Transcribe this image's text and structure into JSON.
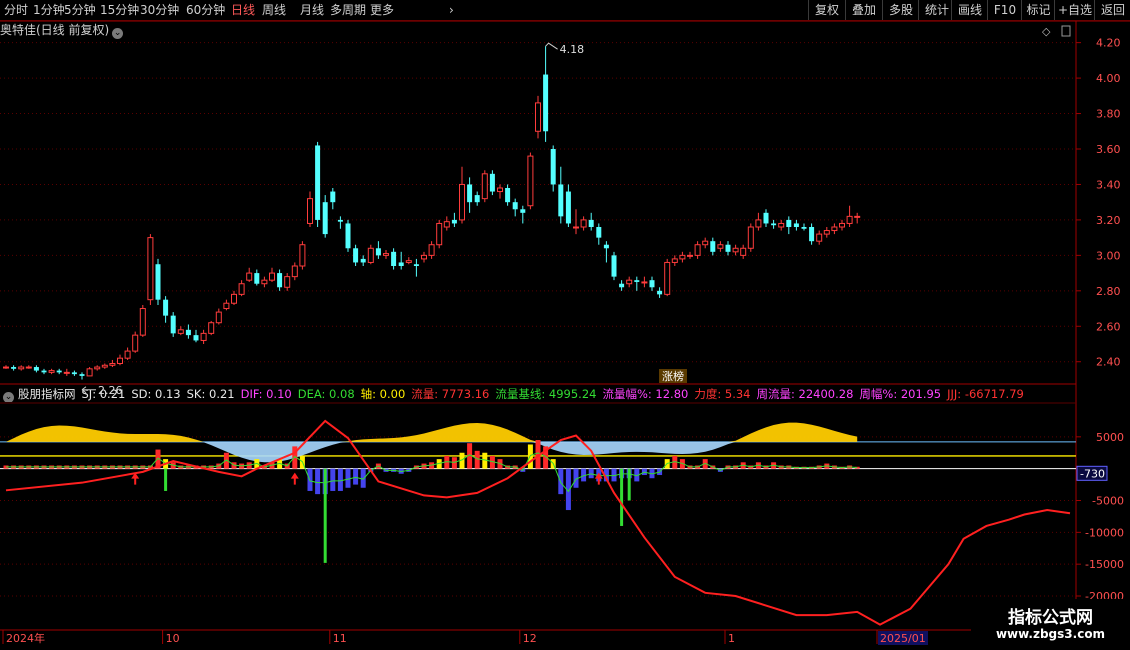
{
  "toolbar": {
    "periods": [
      "分时",
      "1分钟",
      "5分钟",
      "15分钟",
      "30分钟",
      "60分钟",
      "日线",
      "周线",
      "月线",
      "多周期",
      "更多"
    ],
    "active": "日线",
    "more_glyph": "›",
    "right": [
      "复权",
      "叠加",
      "多股",
      "统计",
      "画线",
      "F10",
      "标记",
      "+自选",
      "返回"
    ]
  },
  "title": {
    "text": "奥特佳(日线 前复权)",
    "glyph": "⌄"
  },
  "indicator": {
    "glyph": "⌄",
    "name": "股朋指标网",
    "items": [
      {
        "text": "SJ: 0.21",
        "color": "#e8e8e8"
      },
      {
        "text": "SD: 0.13",
        "color": "#e8e8e8"
      },
      {
        "text": "SK: 0.21",
        "color": "#e8e8e8"
      },
      {
        "text": "DIF: 0.10",
        "color": "#ff44ff"
      },
      {
        "text": "DEA: 0.08",
        "color": "#33dd33"
      },
      {
        "text": "轴: 0.00",
        "color": "#ffee00"
      },
      {
        "text": "流量: 7773.16",
        "color": "#ff3333"
      },
      {
        "text": "流量基线: 4995.24",
        "color": "#33dd33"
      },
      {
        "text": "流量幅%: 12.80",
        "color": "#ff44ff"
      },
      {
        "text": "力度: 5.34",
        "color": "#ff3333"
      },
      {
        "text": "周流量: 22400.28",
        "color": "#ff44ff"
      },
      {
        "text": "周幅%: 201.95",
        "color": "#ff44ff"
      },
      {
        "text": "JJJ: -66717.79",
        "color": "#ff3333"
      }
    ]
  },
  "price_axis": {
    "ticks": [
      "4.20",
      "4.00",
      "3.80",
      "3.60",
      "3.40",
      "3.20",
      "3.00",
      "2.80",
      "2.60",
      "2.40"
    ],
    "values": [
      4.2,
      4.0,
      3.8,
      3.6,
      3.4,
      3.2,
      3.0,
      2.8,
      2.6,
      2.4
    ],
    "range": [
      2.28,
      4.26
    ]
  },
  "ind_axis": {
    "ticks": [
      "5000",
      "-5000",
      "-10000",
      "-15000",
      "-20000"
    ],
    "values": [
      5000,
      -5000,
      -10000,
      -15000,
      -20000
    ],
    "range": [
      -20000,
      10000
    ],
    "current": "-730",
    "current_value": -730
  },
  "date_axis": {
    "labels": [
      {
        "text": "2024年",
        "index": 0
      },
      {
        "text": "10",
        "index": 21
      },
      {
        "text": "11",
        "index": 43
      },
      {
        "text": "12",
        "index": 68
      },
      {
        "text": "1",
        "index": 95
      },
      {
        "text": "2025/01",
        "index": 115
      }
    ]
  },
  "annotations": {
    "high": "4.18",
    "low": "2.26",
    "limit_up_tag": "涨榜"
  },
  "colors": {
    "up": "#ff3c3c",
    "down": "#54ffff",
    "grid": "#5a0000",
    "axis": "#a00000",
    "volume_pos": "#ff2a2a",
    "volume_yellow": "#ffee00",
    "volume_blue": "#4444ee",
    "volume_green": "#33dd33",
    "jjj": "#ff2020",
    "band_yellow": "#ffcc00",
    "band_blue": "#a8d8ff"
  },
  "icons": {
    "diamond": "diamond-icon",
    "scroll": "scroll-icon"
  },
  "chart_data": {
    "type": "candlestick",
    "candles": [
      [
        2.37,
        2.37,
        2.38,
        2.36
      ],
      [
        2.37,
        2.36,
        2.38,
        2.35
      ],
      [
        2.36,
        2.37,
        2.38,
        2.35
      ],
      [
        2.37,
        2.37,
        2.38,
        2.36
      ],
      [
        2.37,
        2.35,
        2.38,
        2.34
      ],
      [
        2.35,
        2.34,
        2.36,
        2.33
      ],
      [
        2.34,
        2.35,
        2.36,
        2.33
      ],
      [
        2.35,
        2.34,
        2.36,
        2.33
      ],
      [
        2.34,
        2.34,
        2.36,
        2.32
      ],
      [
        2.34,
        2.33,
        2.35,
        2.32
      ],
      [
        2.33,
        2.32,
        2.34,
        2.3
      ],
      [
        2.32,
        2.36,
        2.37,
        2.32
      ],
      [
        2.36,
        2.37,
        2.38,
        2.35
      ],
      [
        2.37,
        2.38,
        2.39,
        2.36
      ],
      [
        2.38,
        2.39,
        2.41,
        2.37
      ],
      [
        2.39,
        2.42,
        2.44,
        2.38
      ],
      [
        2.42,
        2.46,
        2.48,
        2.41
      ],
      [
        2.46,
        2.55,
        2.57,
        2.45
      ],
      [
        2.55,
        2.7,
        2.72,
        2.54
      ],
      [
        2.75,
        3.1,
        3.12,
        2.72
      ],
      [
        2.95,
        2.75,
        2.98,
        2.72
      ],
      [
        2.75,
        2.66,
        2.77,
        2.62
      ],
      [
        2.66,
        2.56,
        2.68,
        2.54
      ],
      [
        2.56,
        2.58,
        2.6,
        2.55
      ],
      [
        2.58,
        2.55,
        2.61,
        2.53
      ],
      [
        2.55,
        2.52,
        2.58,
        2.51
      ],
      [
        2.52,
        2.56,
        2.58,
        2.5
      ],
      [
        2.56,
        2.62,
        2.63,
        2.55
      ],
      [
        2.62,
        2.68,
        2.7,
        2.61
      ],
      [
        2.7,
        2.73,
        2.75,
        2.69
      ],
      [
        2.73,
        2.78,
        2.8,
        2.72
      ],
      [
        2.78,
        2.84,
        2.86,
        2.77
      ],
      [
        2.86,
        2.9,
        2.93,
        2.85
      ],
      [
        2.9,
        2.84,
        2.92,
        2.83
      ],
      [
        2.84,
        2.86,
        2.88,
        2.82
      ],
      [
        2.86,
        2.9,
        2.93,
        2.85
      ],
      [
        2.9,
        2.82,
        2.92,
        2.8
      ],
      [
        2.82,
        2.88,
        2.9,
        2.8
      ],
      [
        2.88,
        2.94,
        2.96,
        2.86
      ],
      [
        2.94,
        3.06,
        3.08,
        2.92
      ],
      [
        3.18,
        3.32,
        3.36,
        3.16
      ],
      [
        3.62,
        3.2,
        3.64,
        3.16
      ],
      [
        3.3,
        3.12,
        3.34,
        3.1
      ],
      [
        3.36,
        3.3,
        3.38,
        3.26
      ],
      [
        3.2,
        3.19,
        3.22,
        3.15
      ],
      [
        3.18,
        3.04,
        3.2,
        3.02
      ],
      [
        3.04,
        2.96,
        3.06,
        2.94
      ],
      [
        2.98,
        2.96,
        3.0,
        2.94
      ],
      [
        2.96,
        3.04,
        3.06,
        2.95
      ],
      [
        3.04,
        3.0,
        3.08,
        2.98
      ],
      [
        3.0,
        3.01,
        3.03,
        2.98
      ],
      [
        3.02,
        2.94,
        3.04,
        2.92
      ],
      [
        2.96,
        2.94,
        3.02,
        2.92
      ],
      [
        2.96,
        2.97,
        2.99,
        2.95
      ],
      [
        2.95,
        2.94,
        2.98,
        2.88
      ],
      [
        2.98,
        3.0,
        3.02,
        2.96
      ],
      [
        3.0,
        3.06,
        3.08,
        2.98
      ],
      [
        3.06,
        3.18,
        3.2,
        3.04
      ],
      [
        3.16,
        3.19,
        3.22,
        3.14
      ],
      [
        3.2,
        3.18,
        3.24,
        3.16
      ],
      [
        3.2,
        3.4,
        3.5,
        3.18
      ],
      [
        3.4,
        3.3,
        3.44,
        3.24
      ],
      [
        3.34,
        3.3,
        3.36,
        3.28
      ],
      [
        3.32,
        3.46,
        3.48,
        3.3
      ],
      [
        3.46,
        3.36,
        3.48,
        3.34
      ],
      [
        3.36,
        3.38,
        3.4,
        3.32
      ],
      [
        3.38,
        3.3,
        3.4,
        3.28
      ],
      [
        3.3,
        3.26,
        3.32,
        3.22
      ],
      [
        3.26,
        3.24,
        3.28,
        3.18
      ],
      [
        3.28,
        3.56,
        3.58,
        3.26
      ],
      [
        3.7,
        3.86,
        3.9,
        3.66
      ],
      [
        4.02,
        3.7,
        4.18,
        3.64
      ],
      [
        3.6,
        3.4,
        3.62,
        3.36
      ],
      [
        3.4,
        3.22,
        3.5,
        3.18
      ],
      [
        3.36,
        3.18,
        3.4,
        3.16
      ],
      [
        3.16,
        3.16,
        3.26,
        3.12
      ],
      [
        3.16,
        3.2,
        3.22,
        3.14
      ],
      [
        3.2,
        3.16,
        3.24,
        3.14
      ],
      [
        3.16,
        3.1,
        3.18,
        3.06
      ],
      [
        3.06,
        3.04,
        3.08,
        2.96
      ],
      [
        3.0,
        2.88,
        3.02,
        2.86
      ],
      [
        2.84,
        2.82,
        2.86,
        2.8
      ],
      [
        2.84,
        2.86,
        2.88,
        2.82
      ],
      [
        2.86,
        2.85,
        2.88,
        2.8
      ],
      [
        2.85,
        2.85,
        2.88,
        2.82
      ],
      [
        2.86,
        2.82,
        2.88,
        2.8
      ],
      [
        2.8,
        2.78,
        2.82,
        2.76
      ],
      [
        2.78,
        2.96,
        2.98,
        2.77
      ],
      [
        2.96,
        2.98,
        3.0,
        2.94
      ],
      [
        2.98,
        3.0,
        3.02,
        2.96
      ],
      [
        3.0,
        3.0,
        3.02,
        2.98
      ],
      [
        3.0,
        3.06,
        3.08,
        2.98
      ],
      [
        3.06,
        3.08,
        3.1,
        3.04
      ],
      [
        3.08,
        3.02,
        3.1,
        3.0
      ],
      [
        3.04,
        3.06,
        3.08,
        3.02
      ],
      [
        3.06,
        3.02,
        3.08,
        3.0
      ],
      [
        3.02,
        3.04,
        3.06,
        3.0
      ],
      [
        3.0,
        3.04,
        3.06,
        2.98
      ],
      [
        3.04,
        3.16,
        3.18,
        3.02
      ],
      [
        3.16,
        3.2,
        3.24,
        3.14
      ],
      [
        3.24,
        3.18,
        3.26,
        3.16
      ],
      [
        3.18,
        3.17,
        3.2,
        3.15
      ],
      [
        3.16,
        3.18,
        3.2,
        3.14
      ],
      [
        3.2,
        3.16,
        3.22,
        3.12
      ],
      [
        3.18,
        3.16,
        3.2,
        3.14
      ],
      [
        3.16,
        3.15,
        3.18,
        3.14
      ],
      [
        3.16,
        3.08,
        3.18,
        3.06
      ],
      [
        3.08,
        3.12,
        3.14,
        3.06
      ],
      [
        3.12,
        3.14,
        3.16,
        3.1
      ],
      [
        3.14,
        3.16,
        3.18,
        3.12
      ],
      [
        3.16,
        3.18,
        3.2,
        3.14
      ],
      [
        3.18,
        3.22,
        3.28,
        3.16
      ],
      [
        3.22,
        3.22,
        3.24,
        3.18
      ]
    ],
    "flow": [
      500,
      500,
      500,
      500,
      500,
      500,
      500,
      500,
      500,
      500,
      500,
      500,
      500,
      500,
      500,
      500,
      500,
      500,
      500,
      500,
      3000,
      1500,
      1000,
      500,
      500,
      500,
      500,
      500,
      800,
      2500,
      1000,
      800,
      1000,
      1500,
      500,
      1000,
      1500,
      800,
      3500,
      2000,
      -3500,
      -4000,
      -4000,
      -3500,
      -3500,
      -3000,
      -2500,
      -3000,
      -500,
      800,
      -500,
      -500,
      -800,
      -500,
      500,
      800,
      1000,
      1500,
      2000,
      1800,
      2500,
      4000,
      2800,
      2500,
      2000,
      1500,
      500,
      500,
      -500,
      3800,
      4500,
      3500,
      1500,
      -4000,
      -6500,
      -3000,
      -2000,
      -1500,
      -2000,
      -2000,
      -2000,
      -1500,
      -1500,
      -2000,
      -1000,
      -1500,
      -1000,
      1500,
      2000,
      1500,
      500,
      500,
      1500,
      500,
      -500,
      500,
      500,
      1000,
      500,
      1000,
      500,
      1000,
      500,
      500,
      300,
      300,
      300,
      500,
      800,
      500,
      300,
      500,
      300
    ],
    "flow_spikes": [
      {
        "i": 21,
        "value": -3500,
        "color": "green"
      },
      {
        "i": 42,
        "value": -14800,
        "color": "green"
      },
      {
        "i": 81,
        "value": -9000,
        "color": "green"
      },
      {
        "i": 82,
        "value": -5000,
        "color": "green"
      }
    ],
    "signals": [
      17,
      38,
      78
    ],
    "jjj": [
      [
        0,
        -3400
      ],
      [
        10,
        -2200
      ],
      [
        18,
        -500
      ],
      [
        22,
        1200
      ],
      [
        28,
        -500
      ],
      [
        31,
        -1200
      ],
      [
        33,
        0
      ],
      [
        38,
        2500
      ],
      [
        42,
        7500
      ],
      [
        45,
        4800
      ],
      [
        49,
        -2000
      ],
      [
        55,
        -4200
      ],
      [
        58,
        -4500
      ],
      [
        62,
        -3800
      ],
      [
        66,
        -1500
      ],
      [
        70,
        2000
      ],
      [
        73,
        4500
      ],
      [
        75,
        5200
      ],
      [
        77,
        2800
      ],
      [
        80,
        -3800
      ],
      [
        84,
        -10800
      ],
      [
        88,
        -17000
      ],
      [
        92,
        -19500
      ],
      [
        96,
        -20000
      ],
      [
        100,
        -21500
      ],
      [
        104,
        -23000
      ],
      [
        108,
        -23000
      ],
      [
        112,
        -22500
      ],
      [
        115,
        -24500
      ],
      [
        119,
        -22000
      ],
      [
        124,
        -15000
      ],
      [
        126,
        -11000
      ],
      [
        129,
        -9000
      ],
      [
        132,
        -8000
      ],
      [
        134,
        -7200
      ],
      [
        137,
        -6500
      ],
      [
        140,
        -7000
      ]
    ]
  }
}
